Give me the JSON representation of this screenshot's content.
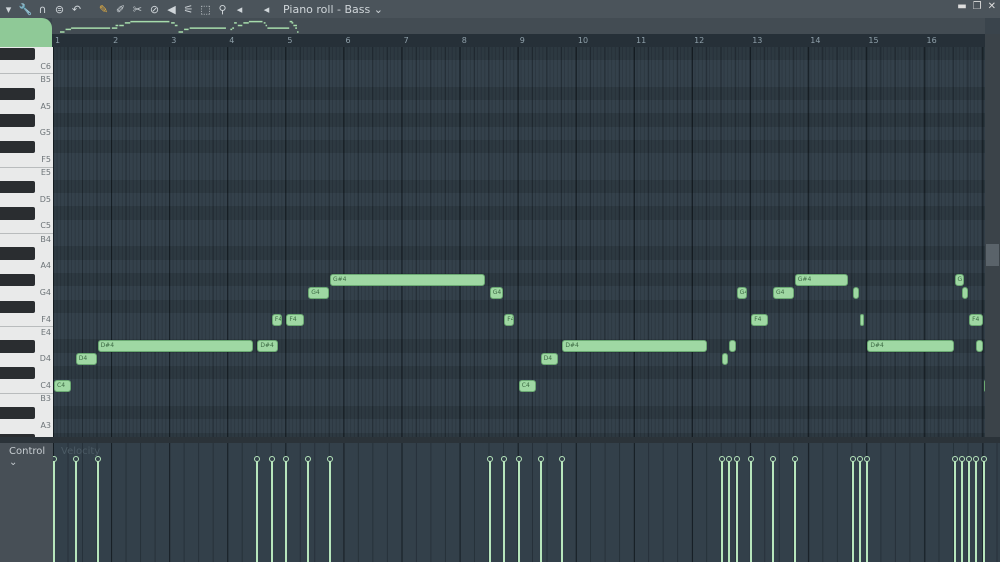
{
  "toolbar": {
    "icons": [
      "menu-arrow-icon",
      "wrench-icon",
      "magnet-icon",
      "stamp-icon",
      "undo-icon",
      "pencil-icon",
      "paint-brush-icon",
      "delete-icon",
      "disable-icon",
      "mute-icon",
      "slice-icon",
      "select-icon",
      "zoom-icon",
      "playback-icon"
    ],
    "title": "Piano roll - Bass",
    "title_arrow": "⌄"
  },
  "window": {
    "minimize": "▬",
    "restore": "❐",
    "close": "✕"
  },
  "ruler": {
    "bars": [
      "1",
      "2",
      "3",
      "4",
      "5",
      "6",
      "7",
      "8",
      "9",
      "10",
      "11",
      "12",
      "13",
      "14",
      "15",
      "16"
    ]
  },
  "keys": {
    "labels": [
      {
        "text": "C6",
        "pitch": 84
      },
      {
        "text": "B5",
        "pitch": 83
      },
      {
        "text": "A5",
        "pitch": 81
      },
      {
        "text": "G5",
        "pitch": 79
      },
      {
        "text": "F5",
        "pitch": 77
      },
      {
        "text": "E5",
        "pitch": 76
      },
      {
        "text": "D5",
        "pitch": 74
      },
      {
        "text": "C5",
        "pitch": 72
      },
      {
        "text": "B4",
        "pitch": 71
      },
      {
        "text": "A4",
        "pitch": 69
      },
      {
        "text": "G4",
        "pitch": 67
      },
      {
        "text": "F4",
        "pitch": 65
      },
      {
        "text": "E4",
        "pitch": 64
      },
      {
        "text": "D4",
        "pitch": 62
      },
      {
        "text": "C4",
        "pitch": 60
      },
      {
        "text": "B3",
        "pitch": 59
      },
      {
        "text": "A3",
        "pitch": 57
      }
    ]
  },
  "notes": [
    {
      "label": "C4",
      "pitch": 60,
      "start": 0,
      "len": 5
    },
    {
      "label": "D4",
      "pitch": 62,
      "start": 6,
      "len": 6
    },
    {
      "label": "D#4",
      "pitch": 63,
      "start": 12,
      "len": 43
    },
    {
      "label": "D#4",
      "pitch": 63,
      "start": 56,
      "len": 6
    },
    {
      "label": "F4",
      "pitch": 65,
      "start": 60,
      "len": 3
    },
    {
      "label": "F4",
      "pitch": 65,
      "start": 64,
      "len": 5
    },
    {
      "label": "G4",
      "pitch": 67,
      "start": 70,
      "len": 6
    },
    {
      "label": "G#4",
      "pitch": 68,
      "start": 76,
      "len": 43
    },
    {
      "label": "G4",
      "pitch": 67,
      "start": 120,
      "len": 4
    },
    {
      "label": "F4",
      "pitch": 65,
      "start": 124,
      "len": 3
    },
    {
      "label": "C4",
      "pitch": 60,
      "start": 128,
      "len": 5
    },
    {
      "label": "D4",
      "pitch": 62,
      "start": 134,
      "len": 5
    },
    {
      "label": "D#4",
      "pitch": 63,
      "start": 140,
      "len": 40
    },
    {
      "label": "",
      "pitch": 62,
      "start": 184,
      "len": 2
    },
    {
      "label": "",
      "pitch": 63,
      "start": 186,
      "len": 2
    },
    {
      "label": "G4",
      "pitch": 67,
      "start": 188,
      "len": 3
    },
    {
      "label": "F4",
      "pitch": 65,
      "start": 192,
      "len": 5
    },
    {
      "label": "G4",
      "pitch": 67,
      "start": 198,
      "len": 6
    },
    {
      "label": "G#4",
      "pitch": 68,
      "start": 204,
      "len": 15
    },
    {
      "label": "",
      "pitch": 67,
      "start": 220,
      "len": 2
    },
    {
      "label": "",
      "pitch": 65,
      "start": 222,
      "len": 1
    },
    {
      "label": "D#4",
      "pitch": 63,
      "start": 224,
      "len": 24
    },
    {
      "label": "G",
      "pitch": 68,
      "start": 248,
      "len": 3
    },
    {
      "label": "",
      "pitch": 67,
      "start": 250,
      "len": 2
    },
    {
      "label": "F4",
      "pitch": 65,
      "start": 252,
      "len": 4
    },
    {
      "label": "",
      "pitch": 63,
      "start": 254,
      "len": 2
    },
    {
      "label": "",
      "pitch": 60,
      "start": 256,
      "len": 1
    }
  ],
  "velocity_level": 0.9,
  "control": {
    "label": "Control ⌄",
    "lane_label": "Velocity"
  },
  "colors": {
    "note": "#9fd8a3",
    "grid": "#34414b",
    "accent": "#8fc997"
  }
}
